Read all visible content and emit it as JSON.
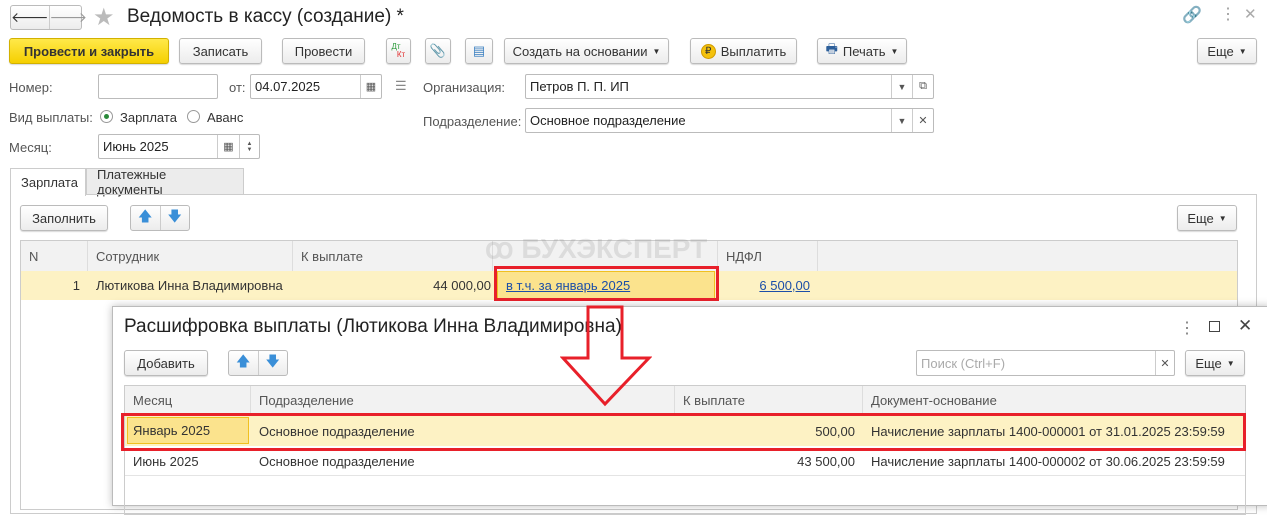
{
  "window": {
    "title": "Ведомость в кассу (создание) *"
  },
  "toolbar": {
    "post_close": "Провести и закрыть",
    "save": "Записать",
    "post": "Провести",
    "dt": "Дт",
    "kt": "Кт",
    "create_based": "Создать на основании",
    "pay": "Выплатить",
    "print": "Печать",
    "more": "Еще"
  },
  "form": {
    "number_label": "Номер:",
    "number_value": "",
    "from_label": "от:",
    "date": "04.07.2025",
    "org_label": "Организация:",
    "org_value": "Петров П. П. ИП",
    "pay_type_label": "Вид выплаты:",
    "pay_type_options": [
      "Зарплата",
      "Аванс"
    ],
    "pay_type_selected": "Зарплата",
    "dept_label": "Подразделение:",
    "dept_value": "Основное подразделение",
    "month_label": "Месяц:",
    "month_value": "Июнь 2025"
  },
  "tabs": [
    "Зарплата",
    "Платежные документы"
  ],
  "salary": {
    "fill": "Заполнить",
    "more": "Еще",
    "columns": [
      "N",
      "Сотрудник",
      "К выплате",
      "",
      "НДФЛ"
    ],
    "rows": [
      {
        "n": "1",
        "employee": "Лютикова Инна Владимировна",
        "amount": "44 000,00",
        "incl": "в т.ч. за январь 2025",
        "ndfl": "6 500,00"
      }
    ]
  },
  "watermark": "БУХЭКСПЕРТ",
  "dialog": {
    "title": "Расшифровка выплаты (Лютикова Инна Владимировна)",
    "add": "Добавить",
    "search_placeholder": "Поиск (Ctrl+F)",
    "more": "Еще",
    "columns": [
      "Месяц",
      "Подразделение",
      "К выплате",
      "Документ-основание"
    ],
    "rows": [
      {
        "month": "Январь 2025",
        "dept": "Основное подразделение",
        "amount": "500,00",
        "doc": "Начисление зарплаты 1400-000001 от 31.01.2025 23:59:59"
      },
      {
        "month": "Июнь 2025",
        "dept": "Основное подразделение",
        "amount": "43 500,00",
        "doc": "Начисление зарплаты 1400-000002 от 30.06.2025 23:59:59"
      }
    ]
  },
  "colors": {
    "accent_yellow": "#f5cf00",
    "row_highlight": "#fdf2c4",
    "annotation_red": "#e8202a"
  }
}
